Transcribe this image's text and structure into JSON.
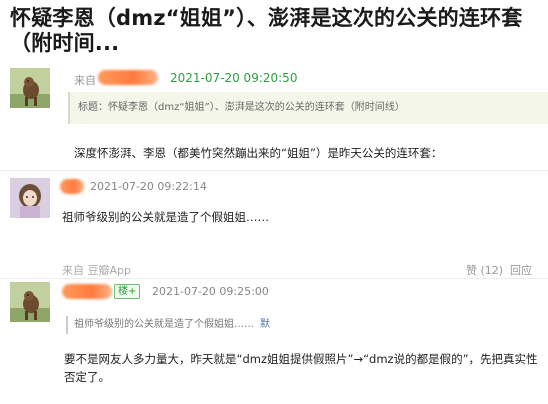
{
  "article": {
    "title": "怀疑李恩（dmz“姐姐”）、澎湃是这次的公关的连环套（附时间..."
  },
  "post": {
    "prefix": "来自",
    "time": "2021-07-20 09:20:50",
    "quote": "标题：怀疑李恩（dmz“姐姐”）、澎湃是这次的公关的连环套（附时间线）",
    "body": "深度怀澎湃、李恩（都美竹突然蹦出来的“姐姐”）是昨天公关的连环套："
  },
  "comment1": {
    "time": "2021-07-20 09:22:14",
    "body": "祖师爷级别的公关就是造了个假姐姐……",
    "source": "来自 豆瓣App",
    "likes": "赞 (12)",
    "reply": "回应"
  },
  "comment2": {
    "badge": "楼+",
    "time": "2021-07-20 09:25:00",
    "quote": "祖师爷级别的公关就是造了个假姐姐……",
    "quote_tag": "默",
    "body_line1": "要不是网友人多力量大，昨天就是“dmz姐姐提供假照片”→“dmz说的都是假的”，先把真实性",
    "body_line2": "否定了。"
  },
  "colors": {
    "time_green": "#2e9e3e",
    "redaction": "#ff7a3d"
  }
}
